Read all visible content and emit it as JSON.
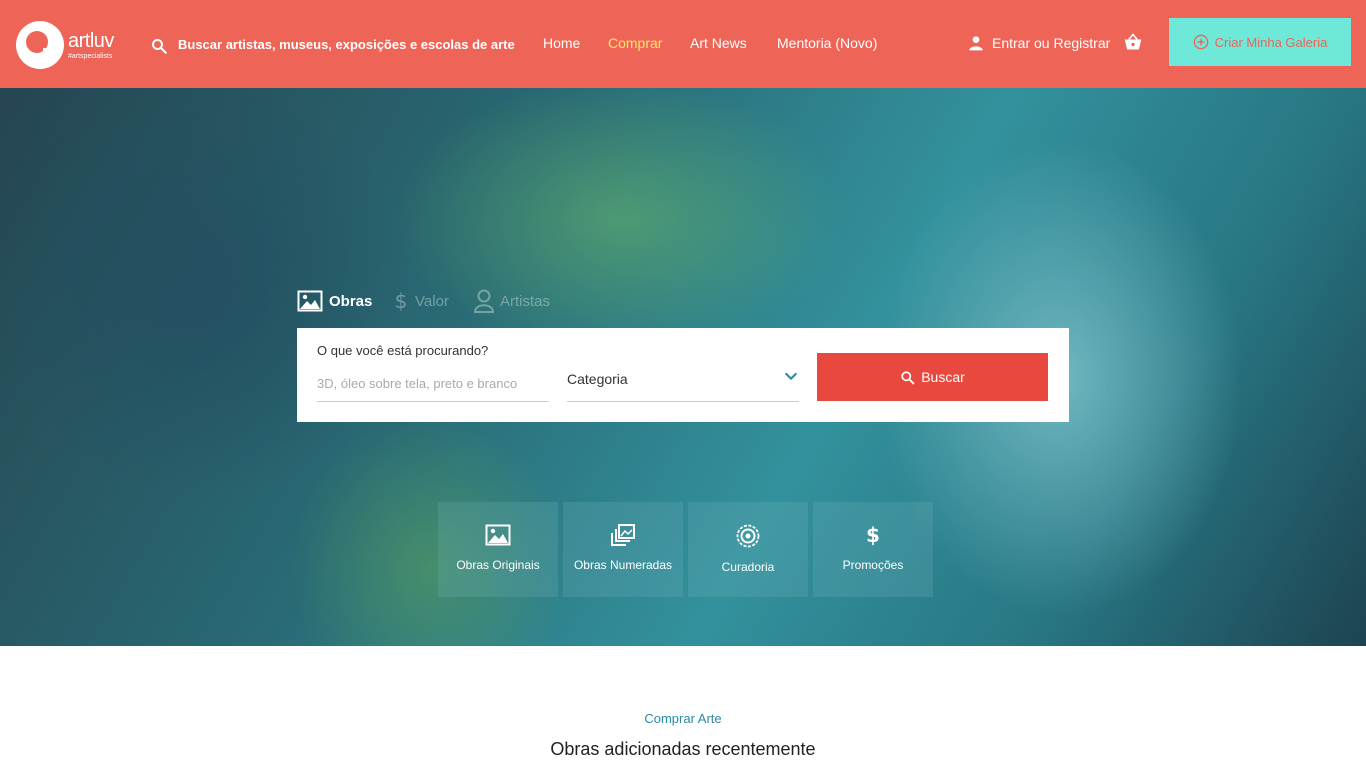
{
  "brand": {
    "name": "artluv",
    "tagline": "#artspecialists"
  },
  "header": {
    "search_text": "Buscar artistas, museus, exposições e escolas de arte",
    "nav": [
      {
        "label": "Home",
        "active": false
      },
      {
        "label": "Comprar",
        "active": true
      },
      {
        "label": "Art News",
        "active": false
      },
      {
        "label": "Mentoria (Novo)",
        "active": false
      }
    ],
    "login_label": "Entrar ou Registrar",
    "cta_label": "Criar Minha Galeria"
  },
  "hero": {
    "tabs": [
      {
        "label": "Obras",
        "icon": "image-icon",
        "active": true
      },
      {
        "label": "Valor",
        "icon": "dollar-icon",
        "active": false
      },
      {
        "label": "Artistas",
        "icon": "person-icon",
        "active": false
      }
    ],
    "search": {
      "label": "O que você está procurando?",
      "placeholder": "3D, óleo sobre tela, preto e branco",
      "category": "Categoria",
      "button_label": "Buscar"
    },
    "tiles": [
      {
        "label": "Obras Originais",
        "icon": "image-icon"
      },
      {
        "label": "Obras Numeradas",
        "icon": "stack-icon"
      },
      {
        "label": "Curadoria",
        "icon": "curation-icon"
      },
      {
        "label": "Promoções",
        "icon": "dollar-icon"
      }
    ]
  },
  "section": {
    "kicker": "Comprar Arte",
    "title": "Obras adicionadas recentemente"
  },
  "colors": {
    "header_bg": "#ee6456",
    "cta_bg": "#6ee9d9",
    "active_nav": "#ffe66b",
    "buscar_bg": "#e8483d",
    "kicker": "#2b8aa6"
  }
}
